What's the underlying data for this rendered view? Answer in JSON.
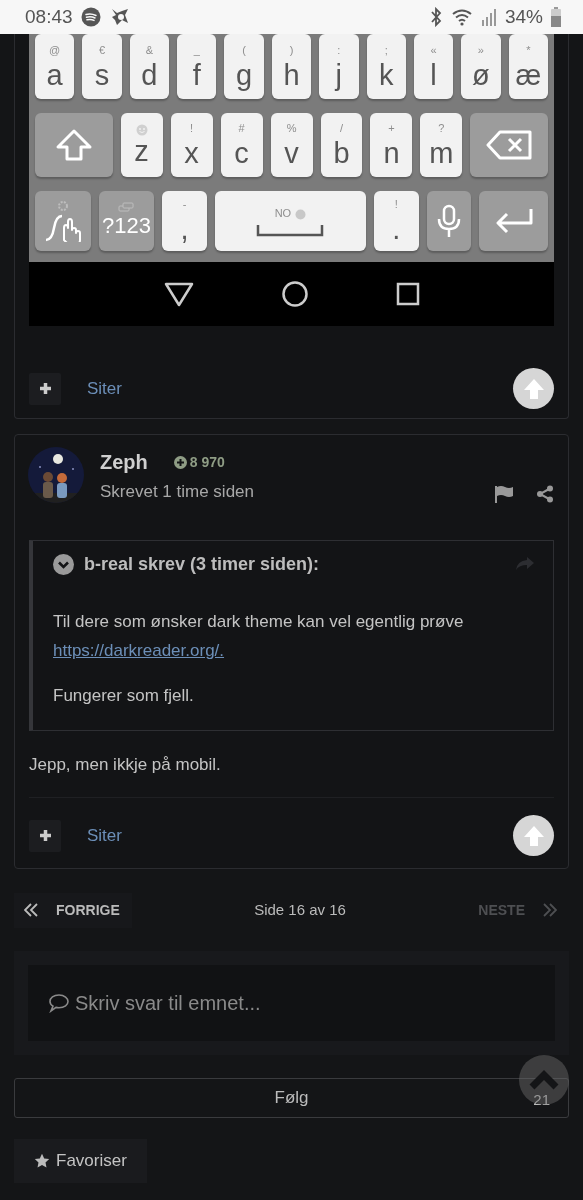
{
  "status_bar": {
    "time": "08:43",
    "battery": "34%"
  },
  "posts": [
    {
      "kind": "screenshot",
      "keyboard": {
        "rows": [
          {
            "keys": [
              {
                "kind": "char",
                "label": "a",
                "hint": "@"
              },
              {
                "kind": "char",
                "label": "s",
                "hint": "€"
              },
              {
                "kind": "char",
                "label": "d",
                "hint": "&"
              },
              {
                "kind": "char",
                "label": "f",
                "hint": "_"
              },
              {
                "kind": "char",
                "label": "g",
                "hint": "("
              },
              {
                "kind": "char",
                "label": "h",
                "hint": ")"
              },
              {
                "kind": "char",
                "label": "j",
                "hint": ":"
              },
              {
                "kind": "char",
                "label": "k",
                "hint": ";"
              },
              {
                "kind": "char",
                "label": "l",
                "hint": "«"
              },
              {
                "kind": "char",
                "label": "ø",
                "hint": "»"
              },
              {
                "kind": "char",
                "label": "æ",
                "hint": "*"
              }
            ]
          },
          {
            "keys": [
              {
                "kind": "shift"
              },
              {
                "kind": "emoji",
                "label": "z"
              },
              {
                "kind": "char",
                "label": "x",
                "hint": "!"
              },
              {
                "kind": "char",
                "label": "c",
                "hint": "#"
              },
              {
                "kind": "char",
                "label": "v",
                "hint": "%"
              },
              {
                "kind": "char",
                "label": "b",
                "hint": "/"
              },
              {
                "kind": "char",
                "label": "n",
                "hint": "+"
              },
              {
                "kind": "char",
                "label": "m",
                "hint": "?"
              },
              {
                "kind": "backspace"
              }
            ]
          },
          {
            "keys": [
              {
                "kind": "gesture"
              },
              {
                "kind": "symbols",
                "label": "?123"
              },
              {
                "kind": "char",
                "label": ",",
                "hint": "-"
              },
              {
                "kind": "space",
                "hint": "NO"
              },
              {
                "kind": "char",
                "label": ".",
                "hint": "!"
              },
              {
                "kind": "mic"
              },
              {
                "kind": "enter"
              }
            ]
          }
        ]
      },
      "quote_label": "Siter"
    },
    {
      "kind": "text",
      "author": "Zeph",
      "reputation": "8 970",
      "posted": "Skrevet 1 time siden",
      "quote": {
        "header": "b-real skrev (3 timer siden):",
        "paragraphs": [
          {
            "text": "Til dere som ønsker dark theme kan vel egentlig prøve ",
            "link": "https://darkreader.org/."
          },
          {
            "text": "Fungerer som fjell."
          }
        ]
      },
      "body": "Jepp, men ikkje på mobil.",
      "quote_label": "Siter"
    }
  ],
  "pagination": {
    "previous": "FORRIGE",
    "previous_disabled": false,
    "page": "Side 16 av 16",
    "next": "NESTE",
    "next_disabled": true
  },
  "reply": {
    "placeholder": "Skriv svar til emnet..."
  },
  "follow": {
    "label": "Følg",
    "count": "21"
  },
  "favorite": {
    "label": "Favoriser"
  }
}
